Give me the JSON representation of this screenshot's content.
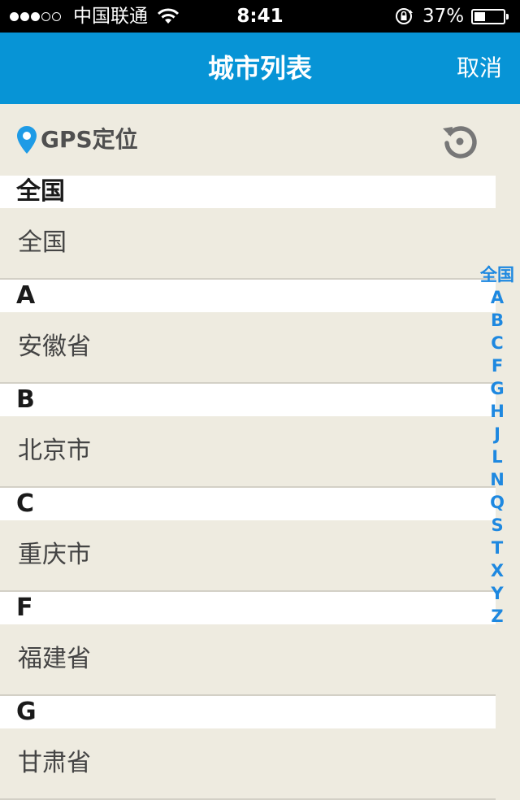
{
  "status_bar": {
    "carrier": "中国联通",
    "time": "8:41",
    "battery_percent": "37%",
    "battery_level": 0.37,
    "signal_bars_filled": 3,
    "signal_bars_total": 5
  },
  "nav": {
    "title": "城市列表",
    "cancel_label": "取消"
  },
  "gps": {
    "label": "GPS定位",
    "pin_icon": "location-pin-icon",
    "refresh_icon": "refresh-icon"
  },
  "groups": [
    {
      "header": "全国",
      "cities": [
        "全国"
      ]
    },
    {
      "header": "A",
      "cities": [
        "安徽省"
      ]
    },
    {
      "header": "B",
      "cities": [
        "北京市"
      ]
    },
    {
      "header": "C",
      "cities": [
        "重庆市"
      ]
    },
    {
      "header": "F",
      "cities": [
        "福建省"
      ]
    },
    {
      "header": "G",
      "cities": [
        "甘肃省"
      ]
    }
  ],
  "index": [
    "全国",
    "A",
    "B",
    "C",
    "F",
    "G",
    "H",
    "J",
    "L",
    "N",
    "Q",
    "S",
    "T",
    "X",
    "Y",
    "Z"
  ],
  "colors": {
    "nav_background": "#0794d6",
    "page_background": "#eeebe0",
    "index_color": "#1e88e0",
    "gps_pin": "#1e9be6"
  }
}
